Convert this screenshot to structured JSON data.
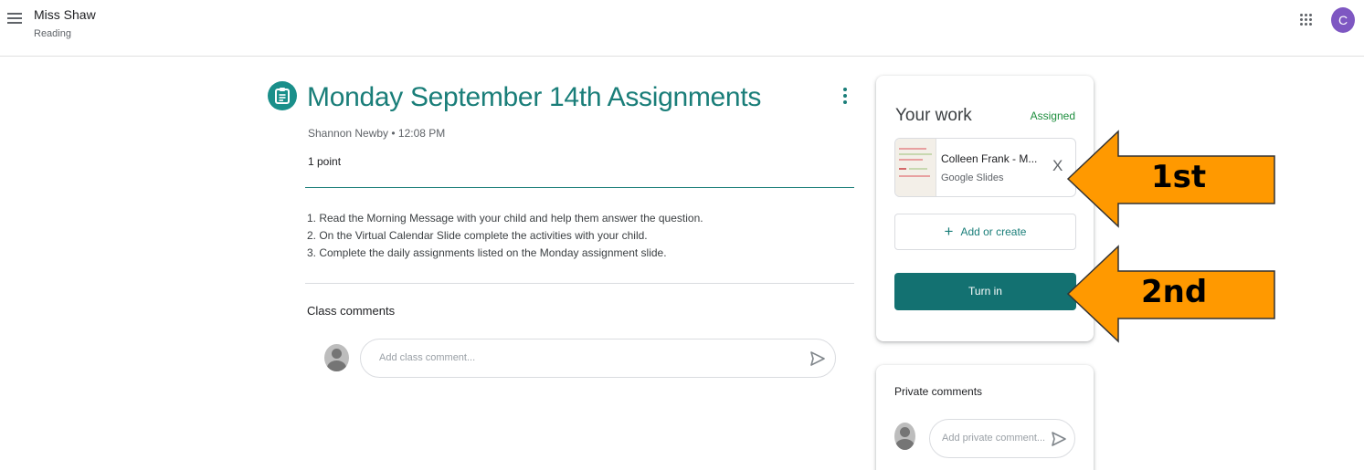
{
  "header": {
    "class_name": "Miss Shaw",
    "class_section": "Reading",
    "avatar_letter": "C",
    "avatar_color": "#7e57c2"
  },
  "assignment": {
    "title": "Monday September 14th Assignments",
    "meta": "Shannon Newby • 12:08 PM",
    "points": "1 point",
    "instructions": [
      "1. Read the Morning Message with your child and help them answer the question.",
      "2. On the Virtual Calendar Slide complete the activities with your child.",
      "3. Complete the daily assignments listed on the Monday assignment slide."
    ],
    "accent_color": "#1a7e79"
  },
  "class_comments": {
    "heading": "Class comments",
    "placeholder": "Add class comment..."
  },
  "your_work": {
    "title": "Your work",
    "status": "Assigned",
    "status_color": "#1e8e3e",
    "attachment": {
      "name": "Colleen Frank - M...",
      "type": "Google Slides",
      "remove_label": "X"
    },
    "add_label": "Add or create",
    "add_symbol": "+",
    "turn_in_label": "Turn in"
  },
  "private_comments": {
    "heading": "Private comments",
    "placeholder": "Add private comment..."
  },
  "annotations": {
    "first_label": "1st",
    "second_label": "2nd",
    "arrow_color": "#ff9900"
  },
  "icons": {
    "menu": "hamburger-menu-icon",
    "apps": "google-apps-grid-icon",
    "assignment": "assignment-clipboard-icon",
    "more": "more-vert-icon",
    "send": "send-icon",
    "remove": "close-icon",
    "add": "plus-icon"
  }
}
